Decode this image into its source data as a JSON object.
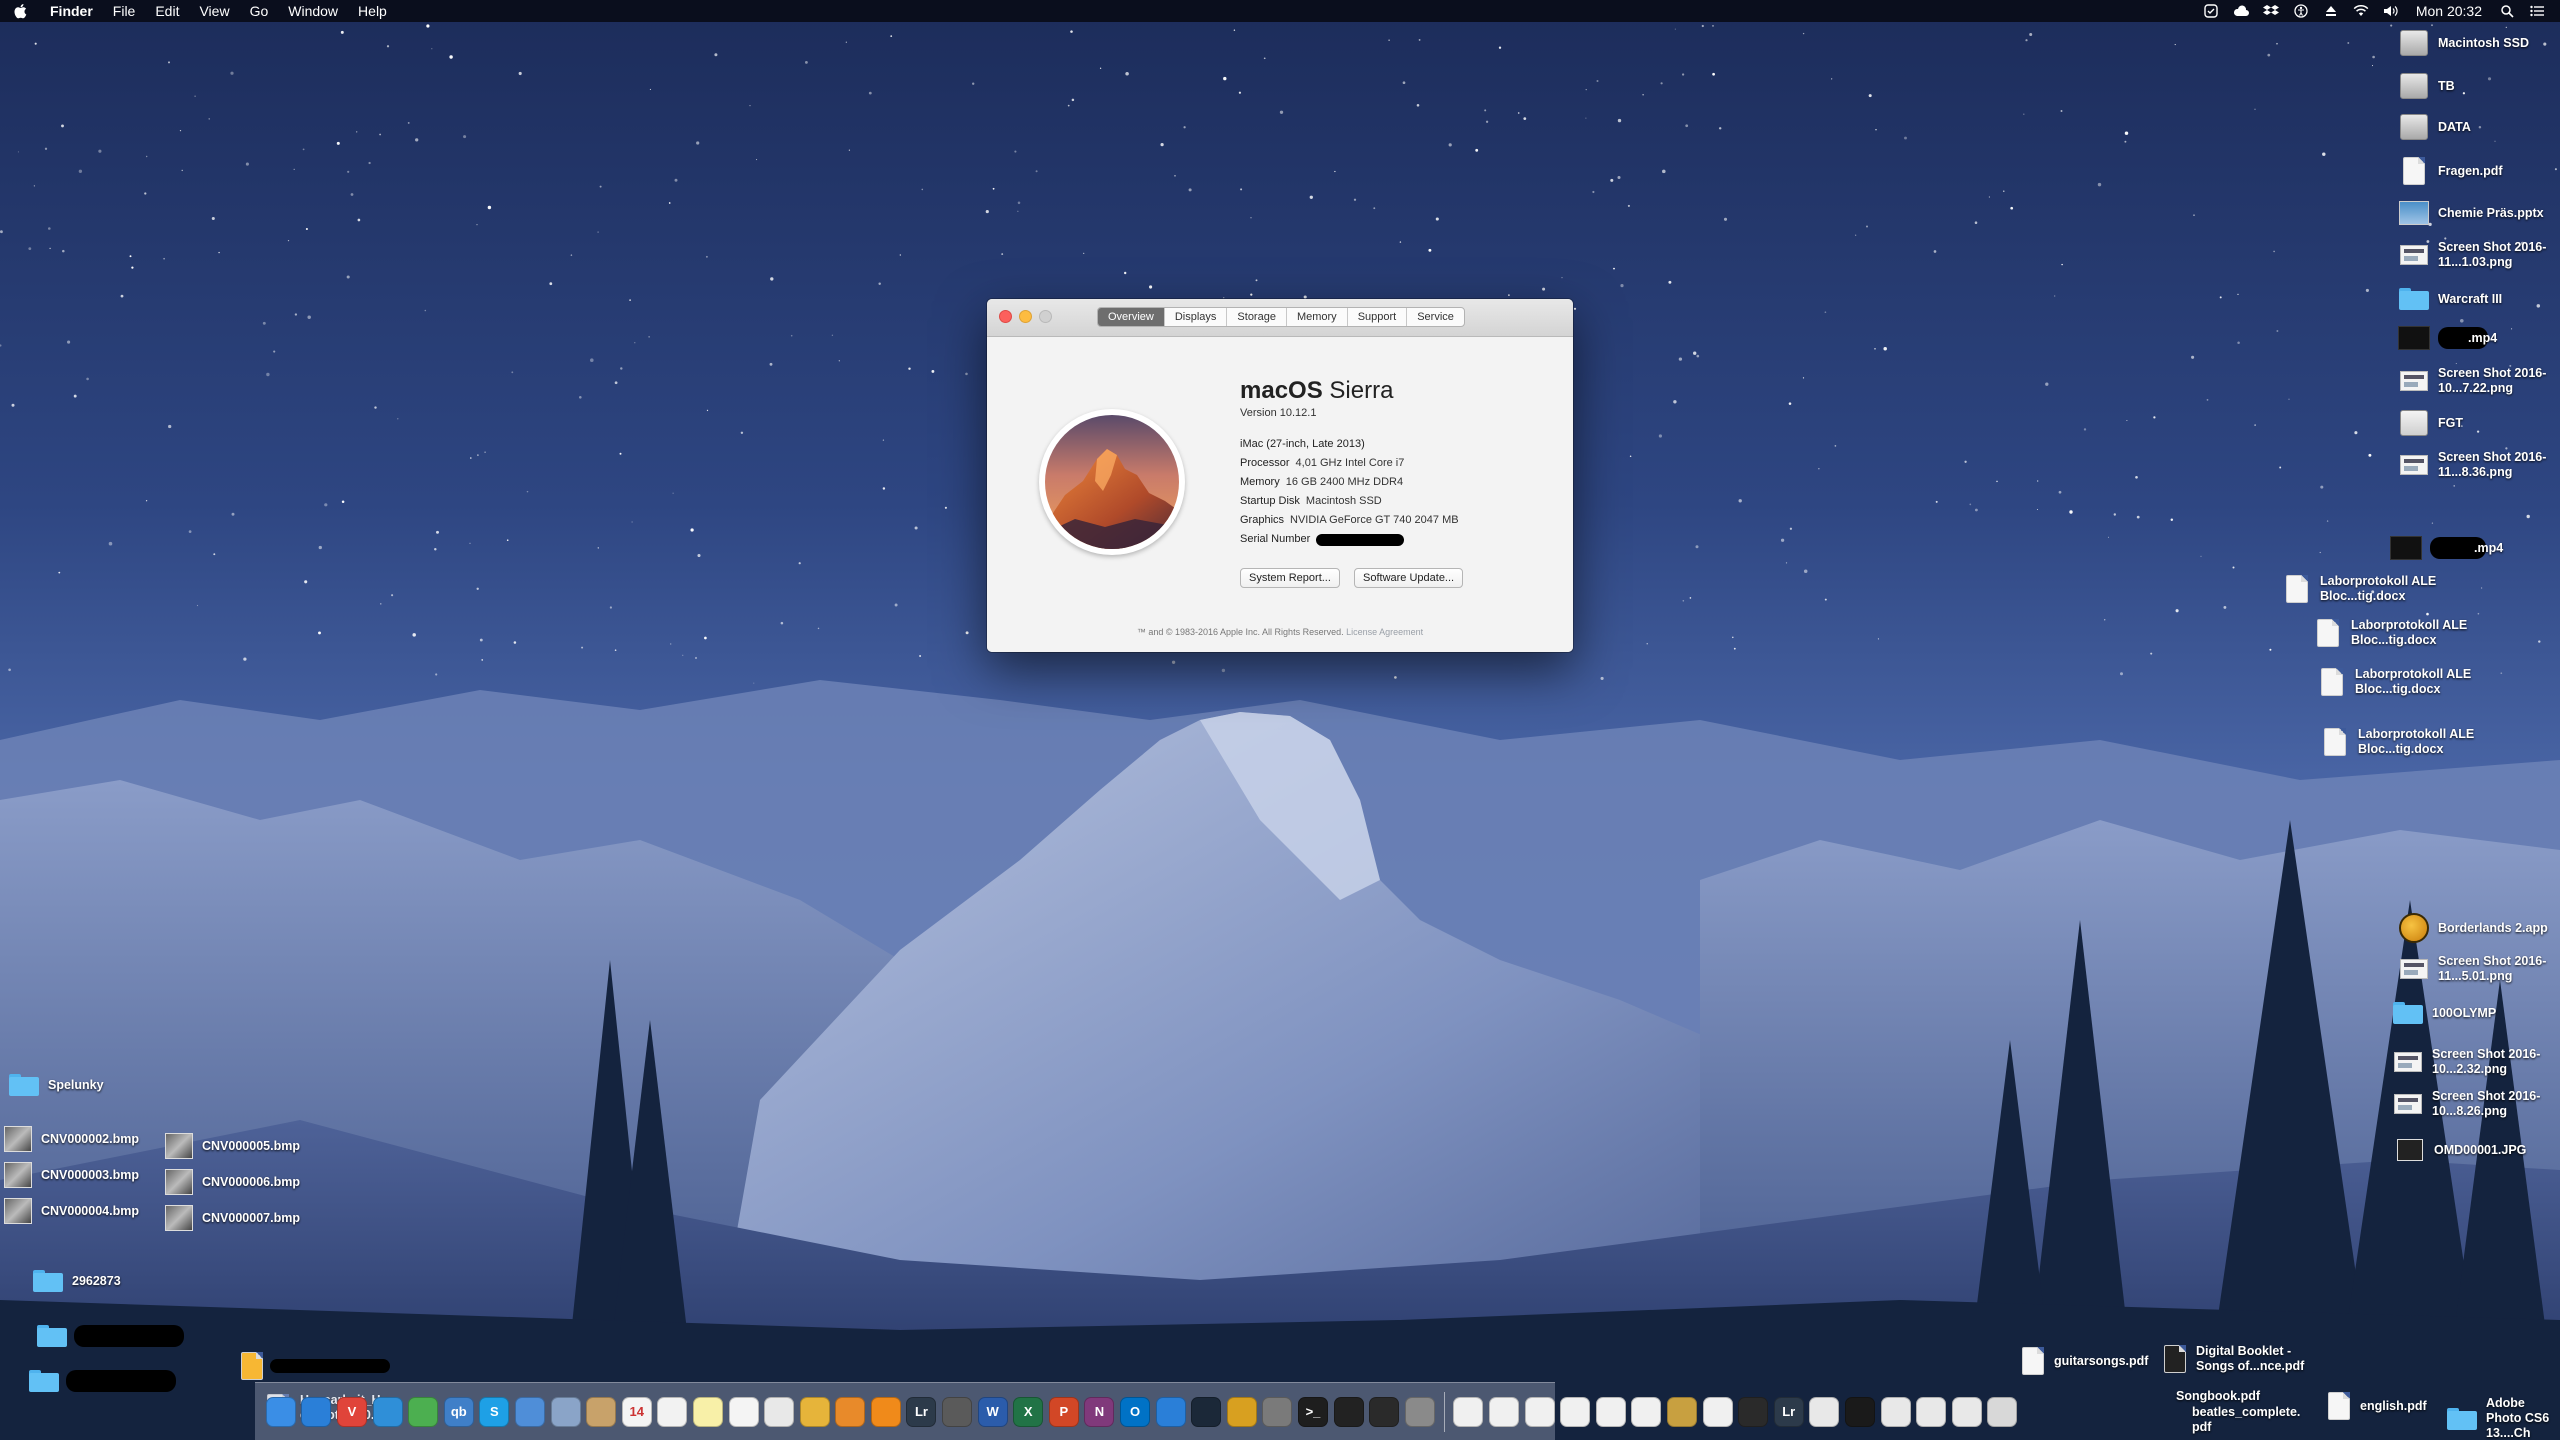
{
  "menubar": {
    "app_name": "Finder",
    "menus": [
      "File",
      "Edit",
      "View",
      "Go",
      "Window",
      "Help"
    ],
    "status_icons": [
      "checkbox-icon",
      "cloud-icon",
      "dropbox-icon",
      "accessibility-icon",
      "eject-icon",
      "wifi-icon",
      "volume-icon"
    ],
    "clock": "Mon 20:32"
  },
  "about_window": {
    "tabs": [
      "Overview",
      "Displays",
      "Storage",
      "Memory",
      "Support",
      "Service"
    ],
    "active_tab": "Overview",
    "os_name_bold": "macOS",
    "os_name_light": "Sierra",
    "version": "Version 10.12.1",
    "model": "iMac (27-inch, Late 2013)",
    "specs": [
      {
        "key": "Processor",
        "value": "4,01 GHz Intel Core i7"
      },
      {
        "key": "Memory",
        "value": "16 GB 2400 MHz DDR4"
      },
      {
        "key": "Startup Disk",
        "value": "Macintosh SSD"
      },
      {
        "key": "Graphics",
        "value": "NVIDIA GeForce GT 740 2047 MB"
      },
      {
        "key": "Serial Number",
        "value": ""
      }
    ],
    "buttons": {
      "system_report": "System Report...",
      "software_update": "Software Update..."
    },
    "footer": "™ and © 1983-2016 Apple Inc. All Rights Reserved.",
    "footer_link": "License Agreement"
  },
  "desktop_right": [
    {
      "label": "Macintosh SSD",
      "icon": "drive-icon"
    },
    {
      "label": "TB",
      "icon": "drive-icon"
    },
    {
      "label": "DATA",
      "icon": "drive-icon"
    },
    {
      "label": "Fragen.pdf",
      "icon": "document-icon"
    },
    {
      "label": "Chemie Präs.pptx",
      "icon": "presentation-icon"
    },
    {
      "label": "Screen Shot 2016-11...1.03.png",
      "icon": "screenshot-icon"
    },
    {
      "label": "Warcraft III",
      "icon": "folder-icon"
    },
    {
      "label": ".mp4",
      "icon": "video-icon"
    },
    {
      "label": "Screen Shot 2016-10...7.22.png",
      "icon": "screenshot-icon"
    },
    {
      "label": "FGT",
      "icon": "drive-icon"
    },
    {
      "label": "Screen Shot 2016-11...8.36.png",
      "icon": "screenshot-icon"
    },
    {
      "label": ".mp4",
      "icon": "video-icon"
    },
    {
      "label": "Laborprotokoll ALE Bloc...tig.docx",
      "icon": "document-icon"
    },
    {
      "label": "Laborprotokoll ALE Bloc...tig.docx",
      "icon": "document-icon"
    },
    {
      "label": "Laborprotokoll ALE Bloc...tig.docx",
      "icon": "document-icon"
    },
    {
      "label": "Laborprotokoll ALE Bloc...tig.docx",
      "icon": "document-icon"
    },
    {
      "label": "Borderlands 2.app",
      "icon": "app-icon"
    },
    {
      "label": "Screen Shot 2016-11...5.01.png",
      "icon": "screenshot-icon"
    },
    {
      "label": "100OLYMP",
      "icon": "folder-icon"
    },
    {
      "label": "Screen Shot 2016-10...2.32.png",
      "icon": "screenshot-icon"
    },
    {
      "label": "Screen Shot 2016-10...8.26.png",
      "icon": "screenshot-icon"
    },
    {
      "label": "OMD00001.JPG",
      "icon": "photo-icon"
    }
  ],
  "desktop_left": [
    {
      "label": "Spelunky",
      "icon": "folder-icon"
    },
    {
      "label": "CNV000002.bmp",
      "icon": "photo-icon"
    },
    {
      "label": "CNV000003.bmp",
      "icon": "photo-icon"
    },
    {
      "label": "CNV000004.bmp",
      "icon": "photo-icon"
    },
    {
      "label": "CNV000005.bmp",
      "icon": "photo-icon"
    },
    {
      "label": "CNV000006.bmp",
      "icon": "photo-icon"
    },
    {
      "label": "CNV000007.bmp",
      "icon": "photo-icon"
    },
    {
      "label": "2962873",
      "icon": "folder-icon"
    },
    {
      "label": "",
      "icon": "folder-icon"
    },
    {
      "label": "",
      "icon": "folder-icon"
    },
    {
      "label": "",
      "icon": "document-icon"
    },
    {
      "label": "Hausarbeit_Hy e_Protok...0.2.",
      "icon": "document-icon"
    }
  ],
  "desktop_bottom_right": [
    {
      "label": "guitarsongs.pdf",
      "icon": "document-icon"
    },
    {
      "label": "Digital Booklet - Songs of...nce.pdf",
      "icon": "document-icon"
    },
    {
      "label": "Songbook.pdf",
      "icon": "document-icon"
    },
    {
      "label": "beatles_complete. pdf",
      "icon": "document-icon"
    },
    {
      "label": "english.pdf",
      "icon": "document-icon"
    },
    {
      "label": "Adobe Photo CS6 13....Ch",
      "icon": "folder-icon"
    }
  ],
  "dock": {
    "apps": [
      {
        "icon": "finder-icon",
        "color": "#3a8ee6",
        "text": ""
      },
      {
        "icon": "safari-icon",
        "color": "#2a7fd8",
        "text": ""
      },
      {
        "icon": "vivaldi-icon",
        "color": "#e0443a",
        "text": "V"
      },
      {
        "icon": "app-store-icon",
        "color": "#2f8fd8",
        "text": ""
      },
      {
        "icon": "maps-icon",
        "color": "#4caf50",
        "text": ""
      },
      {
        "icon": "qbittorrent-icon",
        "color": "#3f7fc8",
        "text": "qb"
      },
      {
        "icon": "skype-icon",
        "color": "#1ea0e6",
        "text": "S"
      },
      {
        "icon": "mail-icon",
        "color": "#4f8ed8",
        "text": ""
      },
      {
        "icon": "preview-icon",
        "color": "#8aa4c8",
        "text": ""
      },
      {
        "icon": "notes-icon",
        "color": "#c8a26a",
        "text": ""
      },
      {
        "icon": "calendar-icon",
        "color": "#f4f4f4",
        "text": "14"
      },
      {
        "icon": "textedit-icon",
        "color": "#f2f2f2",
        "text": ""
      },
      {
        "icon": "stickies-icon",
        "color": "#f8f0a8",
        "text": ""
      },
      {
        "icon": "document-icon",
        "color": "#f4f4f4",
        "text": ""
      },
      {
        "icon": "photos-icon",
        "color": "#e8e8e8",
        "text": ""
      },
      {
        "icon": "chrome-icon",
        "color": "#e6b43a",
        "text": ""
      },
      {
        "icon": "garageband-icon",
        "color": "#e88a2a",
        "text": ""
      },
      {
        "icon": "vlc-icon",
        "color": "#f08a1a",
        "text": ""
      },
      {
        "icon": "lightroom-icon",
        "color": "#2c3a4a",
        "text": "Lr"
      },
      {
        "icon": "script-icon",
        "color": "#5a5a5a",
        "text": ""
      },
      {
        "icon": "word-icon",
        "color": "#2b5cab",
        "text": "W"
      },
      {
        "icon": "excel-icon",
        "color": "#217346",
        "text": "X"
      },
      {
        "icon": "powerpoint-icon",
        "color": "#d24726",
        "text": "P"
      },
      {
        "icon": "onenote-icon",
        "color": "#80397b",
        "text": "N"
      },
      {
        "icon": "outlook-icon",
        "color": "#0072c6",
        "text": "O"
      },
      {
        "icon": "dropbox-icon",
        "color": "#2a7fd8",
        "text": ""
      },
      {
        "icon": "steam-icon",
        "color": "#1b2838",
        "text": ""
      },
      {
        "icon": "borderlands-icon",
        "color": "#d8a020",
        "text": ""
      },
      {
        "icon": "system-preferences-icon",
        "color": "#7a7a7a",
        "text": ""
      },
      {
        "icon": "terminal-icon",
        "color": "#1e1e1e",
        "text": ">_"
      },
      {
        "icon": "activity-monitor-icon",
        "color": "#222",
        "text": ""
      },
      {
        "icon": "console-icon",
        "color": "#2a2a2a",
        "text": ""
      },
      {
        "icon": "disk-utility-icon",
        "color": "#8a8a8a",
        "text": ""
      }
    ],
    "documents": [
      {
        "icon": "document-icon",
        "color": "#f0f0f0",
        "text": ""
      },
      {
        "icon": "document-icon",
        "color": "#f0f0f0",
        "text": ""
      },
      {
        "icon": "document-icon",
        "color": "#f0f0f0",
        "text": ""
      },
      {
        "icon": "document-icon",
        "color": "#f0f0f0",
        "text": ""
      },
      {
        "icon": "document-icon",
        "color": "#f0f0f0",
        "text": ""
      },
      {
        "icon": "document-icon",
        "color": "#f0f0f0",
        "text": ""
      },
      {
        "icon": "archive-icon",
        "color": "#c8a040",
        "text": ""
      },
      {
        "icon": "document-icon",
        "color": "#f0f0f0",
        "text": ""
      },
      {
        "icon": "image-icon",
        "color": "#2a2a2a",
        "text": ""
      },
      {
        "icon": "lightroom-doc-icon",
        "color": "#2c3a4a",
        "text": "Lr"
      },
      {
        "icon": "image-icon",
        "color": "#e8e8e8",
        "text": ""
      },
      {
        "icon": "image-icon",
        "color": "#1a1a1a",
        "text": ""
      },
      {
        "icon": "screenshot-icon",
        "color": "#e8e8e8",
        "text": ""
      },
      {
        "icon": "screenshot-icon",
        "color": "#e8e8e8",
        "text": ""
      },
      {
        "icon": "screenshot-icon",
        "color": "#e8e8e8",
        "text": ""
      },
      {
        "icon": "trash-icon",
        "color": "#d8d8d8",
        "text": ""
      }
    ]
  }
}
